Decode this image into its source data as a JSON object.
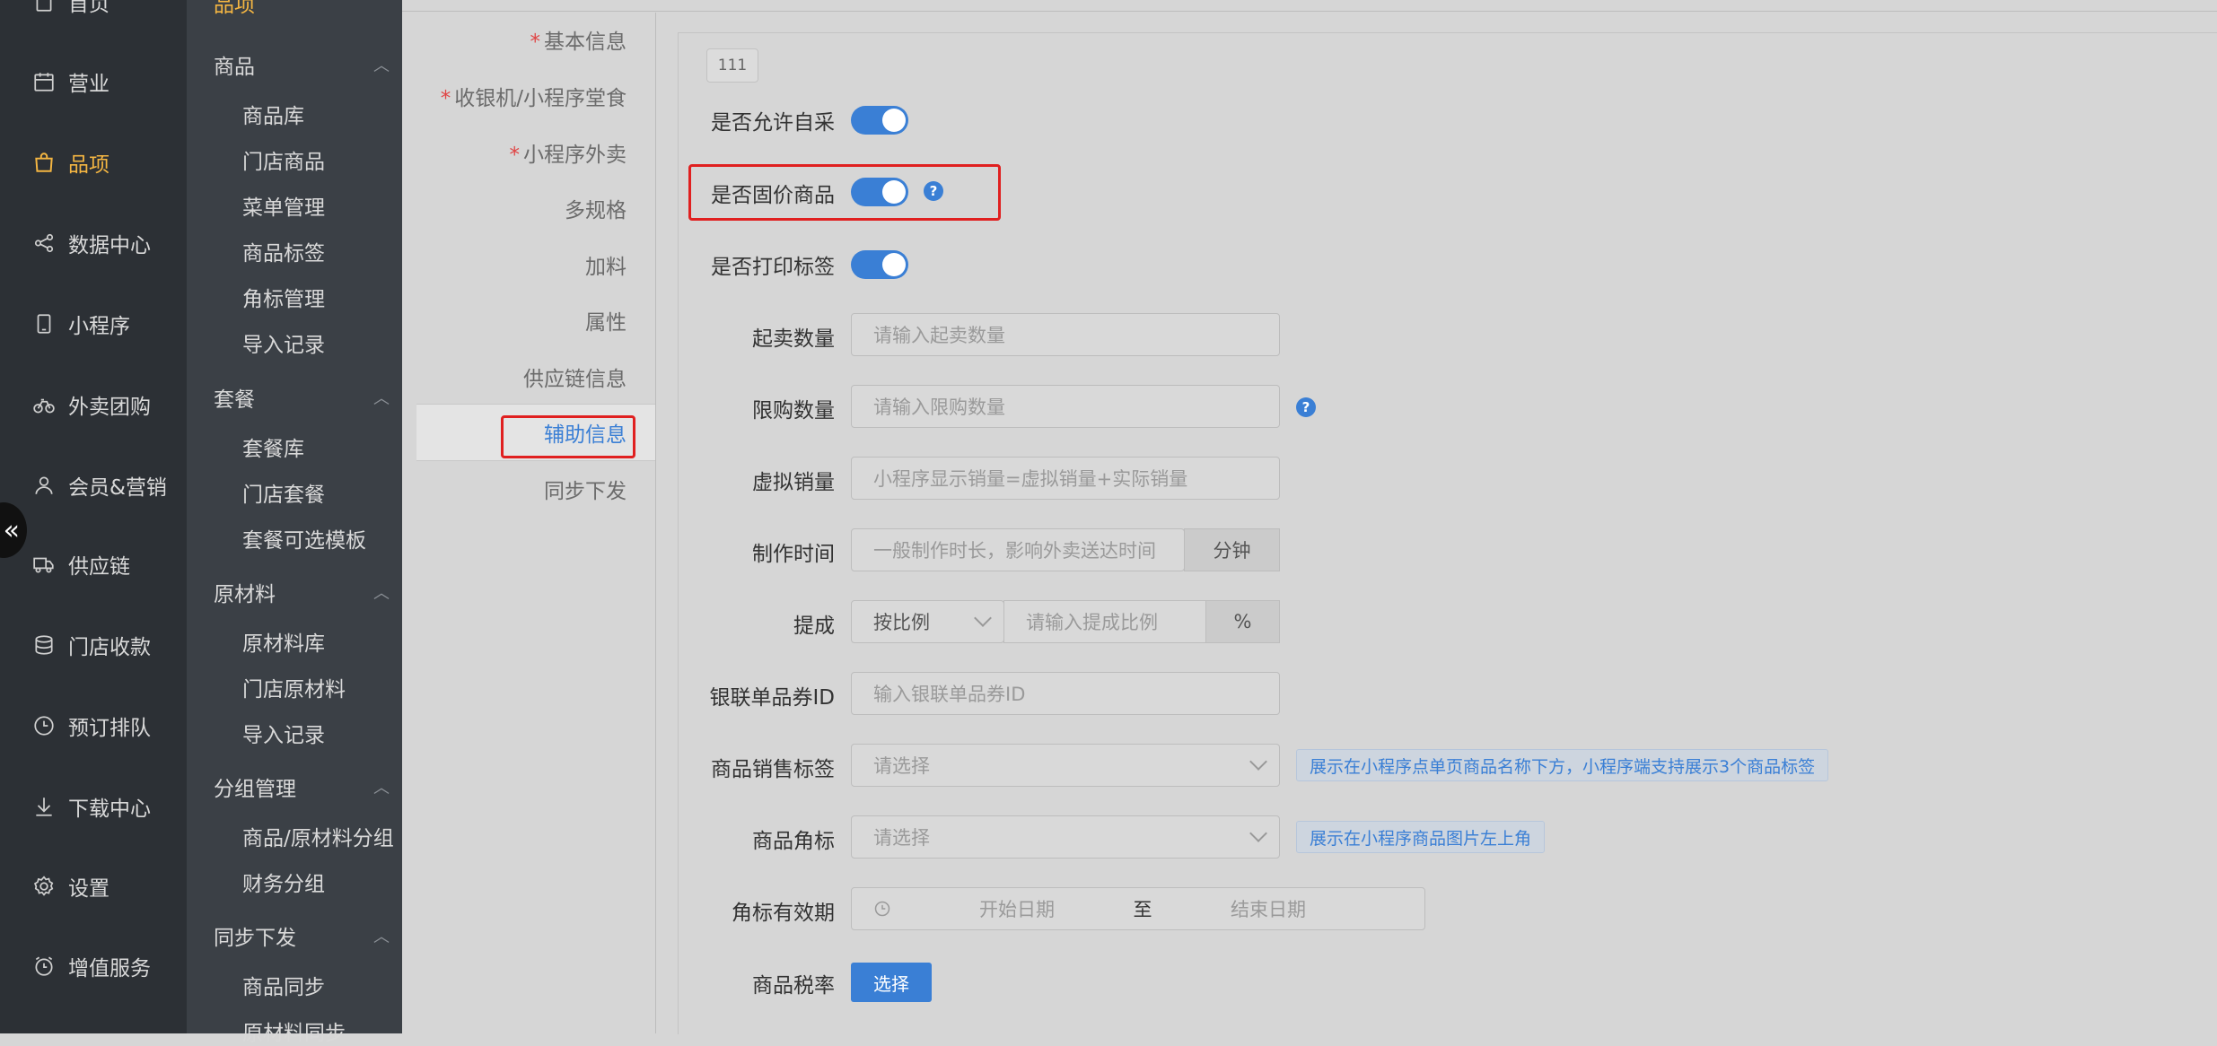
{
  "nav1": {
    "items": [
      {
        "label": "首页",
        "icon": "home-icon"
      },
      {
        "label": "营业",
        "icon": "calendar-icon"
      },
      {
        "label": "品项",
        "icon": "bag-icon"
      },
      {
        "label": "数据中心",
        "icon": "share-icon"
      },
      {
        "label": "小程序",
        "icon": "phone-icon"
      },
      {
        "label": "外卖团购",
        "icon": "bike-icon"
      },
      {
        "label": "会员&营销",
        "icon": "user-icon"
      },
      {
        "label": "供应链",
        "icon": "truck-icon"
      },
      {
        "label": "门店收款",
        "icon": "database-icon"
      },
      {
        "label": "预订排队",
        "icon": "clock-icon"
      },
      {
        "label": "下载中心",
        "icon": "download-icon"
      },
      {
        "label": "设置",
        "icon": "gear-icon"
      },
      {
        "label": "增值服务",
        "icon": "alarm-icon"
      }
    ],
    "collapse": "«",
    "accent": "#f5b642"
  },
  "nav2": {
    "title": "品项",
    "groups": [
      {
        "label": "商品",
        "items": [
          "商品库",
          "门店商品",
          "菜单管理",
          "商品标签",
          "角标管理",
          "导入记录"
        ]
      },
      {
        "label": "套餐",
        "items": [
          "套餐库",
          "门店套餐",
          "套餐可选模板"
        ]
      },
      {
        "label": "原材料",
        "items": [
          "原材料库",
          "门店原材料",
          "导入记录"
        ]
      },
      {
        "label": "分组管理",
        "items": [
          "商品/原材料分组",
          "财务分组"
        ]
      },
      {
        "label": "同步下发",
        "items": [
          "商品同步",
          "原材料同步"
        ]
      }
    ]
  },
  "tabs": [
    {
      "label": "基本信息",
      "required": "*"
    },
    {
      "label": "收银机/小程序堂食",
      "required": "*"
    },
    {
      "label": "小程序外卖",
      "required": "*"
    },
    {
      "label": "多规格"
    },
    {
      "label": "加料"
    },
    {
      "label": "属性"
    },
    {
      "label": "供应链信息"
    },
    {
      "label": "辅助信息"
    },
    {
      "label": "同步下发"
    }
  ],
  "form": {
    "tag": "111",
    "allow_self_purchase": {
      "label": "是否允许自采",
      "on": true
    },
    "fixed_price": {
      "label": "是否固价商品",
      "on": true
    },
    "print_label": {
      "label": "是否打印标签",
      "on": true
    },
    "min_qty": {
      "label": "起卖数量",
      "placeholder": "请输入起卖数量"
    },
    "limit_qty": {
      "label": "限购数量",
      "placeholder": "请输入限购数量"
    },
    "virtual_sales": {
      "label": "虚拟销量",
      "placeholder": "小程序显示销量=虚拟销量+实际销量"
    },
    "prep_time": {
      "label": "制作时间",
      "placeholder": "一般制作时长，影响外卖送达时间",
      "unit": "分钟"
    },
    "commission": {
      "label": "提成",
      "mode": "按比例",
      "placeholder": "请输入提成比例",
      "unit": "%"
    },
    "unionpay_id": {
      "label": "银联单品券ID",
      "placeholder": "输入银联单品券ID"
    },
    "sales_tag": {
      "label": "商品销售标签",
      "placeholder": "请选择",
      "hint": "展示在小程序点单页商品名称下方，小程序端支持展示3个商品标签"
    },
    "corner_mark": {
      "label": "商品角标",
      "placeholder": "请选择",
      "hint": "展示在小程序商品图片左上角"
    },
    "corner_validity": {
      "label": "角标有效期",
      "start": "开始日期",
      "sep": "至",
      "end": "结束日期"
    },
    "tax_rate": {
      "label": "商品税率",
      "button": "选择"
    },
    "help": "?"
  },
  "colors": {
    "primary": "#3a7fd5",
    "highlight": "#e02020"
  }
}
